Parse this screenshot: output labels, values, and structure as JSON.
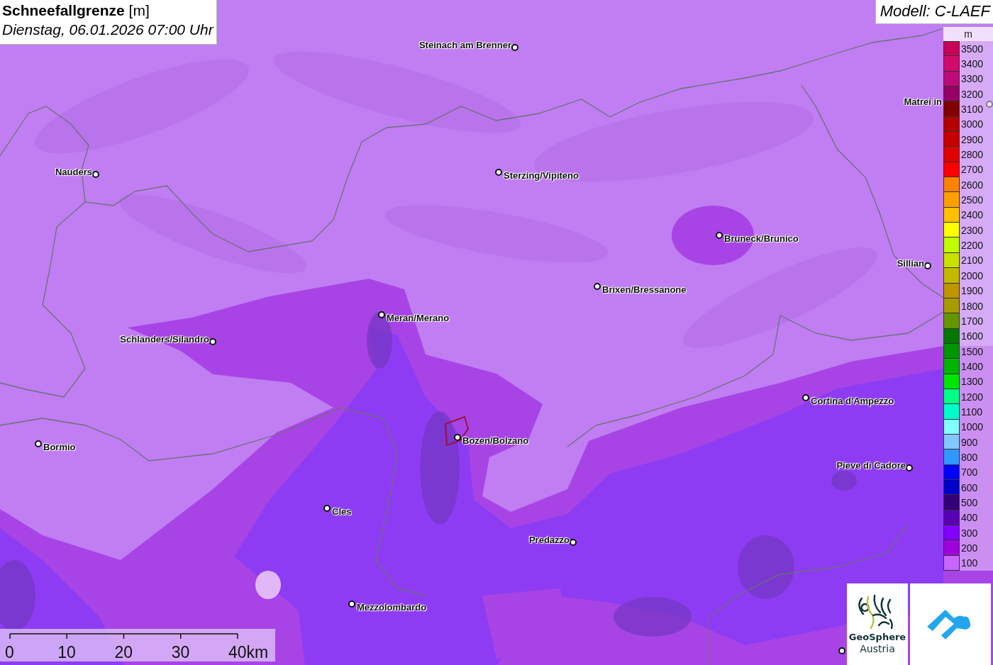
{
  "title": {
    "heading": "**Schneefallgrenze** [m]",
    "time": "Dienstag, 06.01.2026 07:00 Uhr"
  },
  "model": "Modell: C-LAEF",
  "places": [
    {
      "kind": "town",
      "name": "Steinach am Brenner"
    },
    {
      "kind": "town",
      "name": "Nauders"
    },
    {
      "kind": "town",
      "name": "Sterzing/Vipiteno"
    },
    {
      "kind": "town",
      "name": "Matrei in"
    },
    {
      "kind": "town",
      "name": "Bruneck/Brunico"
    },
    {
      "kind": "town",
      "name": "Sillian"
    },
    {
      "kind": "town",
      "name": "Brixen/Bressanone"
    },
    {
      "kind": "town",
      "name": "Meran/Merano"
    },
    {
      "kind": "town",
      "name": "Schlanders/Silandro"
    },
    {
      "kind": "town",
      "name": "Cortina d'Ampezzo"
    },
    {
      "kind": "town",
      "name": "Bormio"
    },
    {
      "kind": "town",
      "name": "Bozen/Bolzano"
    },
    {
      "kind": "town",
      "name": "Pieve di Cadore"
    },
    {
      "kind": "town",
      "name": "Cles"
    },
    {
      "kind": "town",
      "name": "Predazzo"
    },
    {
      "kind": "town",
      "name": "Mezzolombardo"
    },
    {
      "kind": "dot"
    }
  ],
  "legend": {
    "unit": "m",
    "classes": [
      {
        "label": "3500",
        "color": "#c8005a"
      },
      {
        "label": "3400",
        "color": "#d20a6e"
      },
      {
        "label": "3300",
        "color": "#be0a78"
      },
      {
        "label": "3200",
        "color": "#960064"
      },
      {
        "label": "3100",
        "color": "#820000"
      },
      {
        "label": "3000",
        "color": "#b40000"
      },
      {
        "label": "2900",
        "color": "#c80000"
      },
      {
        "label": "2800",
        "color": "#e10000"
      },
      {
        "label": "2700",
        "color": "#ff0000"
      },
      {
        "label": "2600",
        "color": "#ff8200"
      },
      {
        "label": "2500",
        "color": "#ffa000"
      },
      {
        "label": "2400",
        "color": "#ffc000"
      },
      {
        "label": "2300",
        "color": "#ffff00"
      },
      {
        "label": "2200",
        "color": "#c0ff00"
      },
      {
        "label": "2100",
        "color": "#c8e100"
      },
      {
        "label": "2000",
        "color": "#c3b900"
      },
      {
        "label": "1900",
        "color": "#be9600"
      },
      {
        "label": "1800",
        "color": "#a89b00"
      },
      {
        "label": "1700",
        "color": "#649600"
      },
      {
        "label": "1600",
        "color": "#007800"
      },
      {
        "label": "1500",
        "color": "#009600"
      },
      {
        "label": "1400",
        "color": "#00b400"
      },
      {
        "label": "1300",
        "color": "#00e600"
      },
      {
        "label": "1200",
        "color": "#00ff82"
      },
      {
        "label": "1100",
        "color": "#00ffc8"
      },
      {
        "label": "1000",
        "color": "#82ffff"
      },
      {
        "label": "900",
        "color": "#82c8ff"
      },
      {
        "label": "800",
        "color": "#3296ff"
      },
      {
        "label": "700",
        "color": "#0000ff"
      },
      {
        "label": "600",
        "color": "#0000c8"
      },
      {
        "label": "500",
        "color": "#320078"
      },
      {
        "label": "400",
        "color": "#5a00b4"
      },
      {
        "label": "300",
        "color": "#8200ff"
      },
      {
        "label": "200",
        "color": "#a000dc"
      },
      {
        "label": "100",
        "color": "#c864ff"
      }
    ]
  },
  "scale_bar": {
    "ticks": [
      "0",
      "10",
      "20",
      "30",
      "40km"
    ]
  },
  "logos": [
    {
      "kind": "geosphere",
      "lines": [
        "GeoSphere",
        "Austria"
      ]
    },
    {
      "kind": "app"
    }
  ]
}
